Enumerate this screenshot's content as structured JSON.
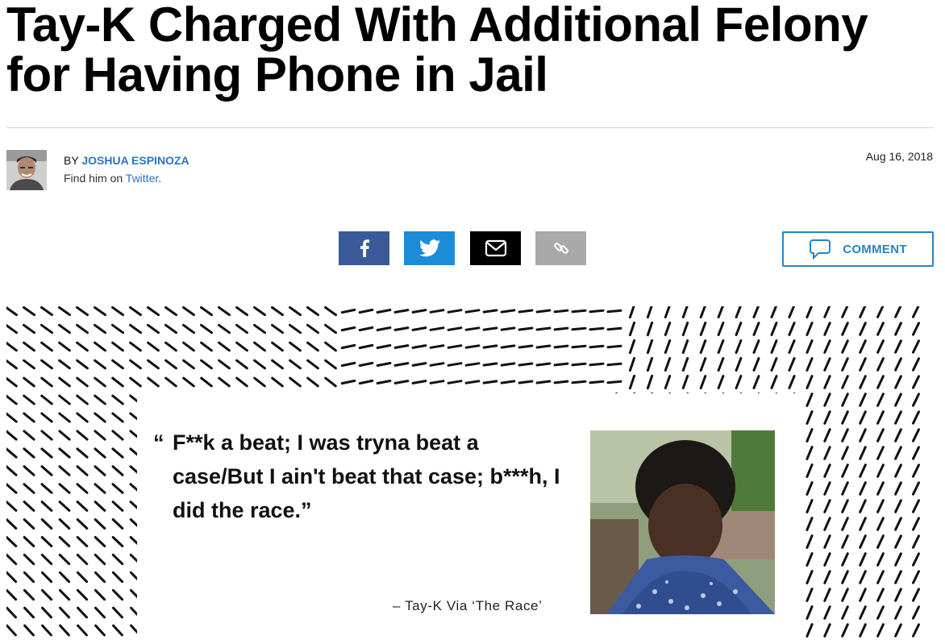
{
  "article": {
    "headline": "Tay-K Charged With Additional Felony for Having Phone in Jail",
    "byline_prefix": "BY",
    "author": "JOSHUA ESPINOZA",
    "find_text": "Find him on",
    "twitter_label": "Twitter",
    "find_suffix": ".",
    "date": "Aug 16, 2018"
  },
  "share": {
    "facebook_icon": "facebook-icon",
    "twitter_icon": "twitter-icon",
    "email_icon": "email-icon",
    "link_icon": "link-icon",
    "comment_label": "COMMENT"
  },
  "hero": {
    "quote_mark": "“",
    "quote": "F**k a beat; I was tryna beat a case/But I ain't beat that case; b***h, I did the race.”",
    "attribution": "– Tay-K Via ‘The Race’"
  },
  "colors": {
    "facebook": "#3b5998",
    "twitter": "#1d8cd8",
    "email": "#000000",
    "link": "#a9a9a9",
    "accent": "#2585c6"
  }
}
